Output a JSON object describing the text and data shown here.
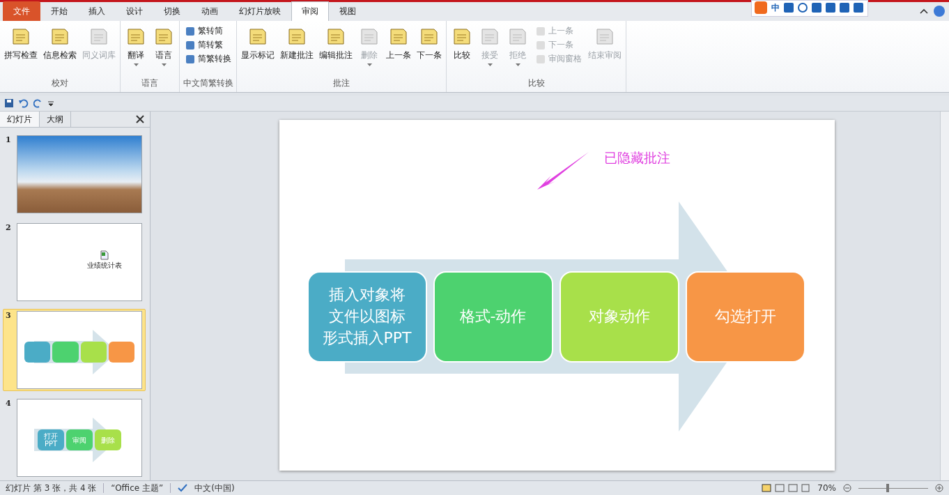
{
  "tabs": [
    {
      "label": "文件",
      "kind": "file",
      "selected": false
    },
    {
      "label": "开始",
      "kind": "tab",
      "selected": false
    },
    {
      "label": "插入",
      "kind": "tab",
      "selected": false
    },
    {
      "label": "设计",
      "kind": "tab",
      "selected": false
    },
    {
      "label": "切换",
      "kind": "tab",
      "selected": false
    },
    {
      "label": "动画",
      "kind": "tab",
      "selected": false
    },
    {
      "label": "幻灯片放映",
      "kind": "tab",
      "selected": false
    },
    {
      "label": "审阅",
      "kind": "tab",
      "selected": true
    },
    {
      "label": "视图",
      "kind": "tab",
      "selected": false
    }
  ],
  "ime_toolbar": {
    "mode": "中"
  },
  "ribbon": {
    "groups": [
      {
        "label": "校对",
        "items": [
          {
            "kind": "large",
            "label": "拼写检查",
            "disabled": false,
            "dropdown": false
          },
          {
            "kind": "large",
            "label": "信息检索",
            "disabled": false,
            "dropdown": false
          },
          {
            "kind": "large",
            "label": "同义词库",
            "disabled": true,
            "dropdown": false
          }
        ]
      },
      {
        "label": "语言",
        "items": [
          {
            "kind": "large",
            "label": "翻译",
            "disabled": false,
            "dropdown": true
          },
          {
            "kind": "large",
            "label": "语言",
            "disabled": false,
            "dropdown": true
          }
        ]
      },
      {
        "label": "中文简繁转换",
        "items": [
          {
            "kind": "stack",
            "buttons": [
              {
                "label": "繁转简",
                "disabled": false
              },
              {
                "label": "简转繁",
                "disabled": false
              },
              {
                "label": "简繁转换",
                "disabled": false
              }
            ]
          }
        ]
      },
      {
        "label": "批注",
        "items": [
          {
            "kind": "large",
            "label": "显示标记",
            "disabled": false,
            "dropdown": false
          },
          {
            "kind": "large",
            "label": "新建批注",
            "disabled": false,
            "dropdown": false
          },
          {
            "kind": "large",
            "label": "编辑批注",
            "disabled": false,
            "dropdown": false
          },
          {
            "kind": "large",
            "label": "删除",
            "disabled": true,
            "dropdown": true
          },
          {
            "kind": "large",
            "label": "上一条",
            "disabled": false,
            "dropdown": false
          },
          {
            "kind": "large",
            "label": "下一条",
            "disabled": false,
            "dropdown": false
          }
        ]
      },
      {
        "label": "比较",
        "items": [
          {
            "kind": "large",
            "label": "比较",
            "disabled": false,
            "dropdown": false
          },
          {
            "kind": "large",
            "label": "接受",
            "disabled": true,
            "dropdown": true
          },
          {
            "kind": "large",
            "label": "拒绝",
            "disabled": true,
            "dropdown": true
          },
          {
            "kind": "stack",
            "buttons": [
              {
                "label": "上一条",
                "disabled": true
              },
              {
                "label": "下一条",
                "disabled": true
              },
              {
                "label": "审阅窗格",
                "disabled": true
              }
            ]
          },
          {
            "kind": "large",
            "label": "结束审阅",
            "disabled": true,
            "dropdown": false
          }
        ]
      }
    ]
  },
  "panel": {
    "tabs": [
      {
        "label": "幻灯片",
        "selected": true
      },
      {
        "label": "大纲",
        "selected": false
      }
    ],
    "slides": [
      {
        "number": "1",
        "kind": "photo",
        "selected": false
      },
      {
        "number": "2",
        "kind": "object",
        "selected": false,
        "labels": [
          "业绩统计表"
        ]
      },
      {
        "number": "3",
        "kind": "process",
        "selected": true
      },
      {
        "number": "4",
        "kind": "process",
        "selected": false,
        "labels": [
          "打开\nPPT",
          "审阅",
          "删除"
        ]
      }
    ]
  },
  "slide": {
    "annotation": "已隐藏批注",
    "steps": [
      {
        "lines": [
          "插入对象将",
          "文件以图标",
          "形式插入PPT"
        ],
        "color": "#4bacc6"
      },
      {
        "lines": [
          "格式-动作"
        ],
        "color": "#4dd26f"
      },
      {
        "lines": [
          "对象动作"
        ],
        "color": "#a8e04a"
      },
      {
        "lines": [
          "勾选打开"
        ],
        "color": "#f79646"
      }
    ]
  },
  "status_bar": {
    "slide_info": "幻灯片 第 3 张，共 4 张",
    "theme": "“Office 主题”",
    "language": "中文(中国)",
    "zoom": "70%",
    "zoom_slider": {
      "level": 0.42
    }
  }
}
